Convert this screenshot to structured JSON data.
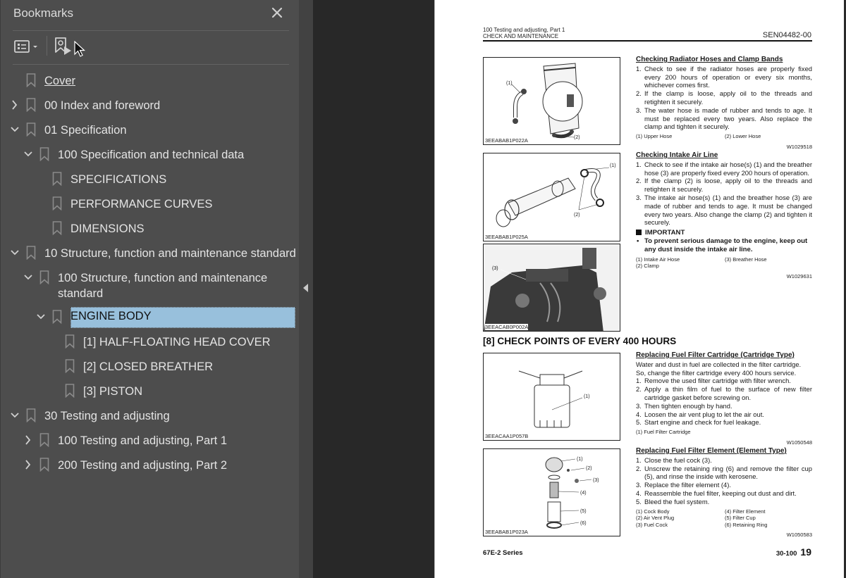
{
  "sidebar": {
    "title": "Bookmarks",
    "close_icon": "close-icon",
    "toolbar": {
      "options_icon": "bookmark-options-icon",
      "add_bookmark_icon": "add-bookmark-icon"
    },
    "items": [
      {
        "label": "Cover",
        "level": 0,
        "expander": "none",
        "underlined": true
      },
      {
        "label": "00 Index and foreword",
        "level": 0,
        "expander": "collapsed"
      },
      {
        "label": "01 Specification",
        "level": 0,
        "expander": "expanded"
      },
      {
        "label": "100 Specification and technical data",
        "level": 1,
        "expander": "expanded"
      },
      {
        "label": "SPECIFICATIONS",
        "level": 2,
        "expander": "none"
      },
      {
        "label": "PERFORMANCE CURVES",
        "level": 2,
        "expander": "none"
      },
      {
        "label": "DIMENSIONS",
        "level": 2,
        "expander": "none"
      },
      {
        "label": "10 Structure, function and maintenance standard",
        "level": 0,
        "expander": "expanded"
      },
      {
        "label": "100 Structure, function and maintenance standard",
        "level": 1,
        "expander": "expanded"
      },
      {
        "label": "ENGINE BODY",
        "level": 2,
        "expander": "expanded",
        "selected": true
      },
      {
        "label": "[1] HALF-FLOATING HEAD COVER",
        "level": 3,
        "expander": "none"
      },
      {
        "label": "[2] CLOSED BREATHER",
        "level": 3,
        "expander": "none"
      },
      {
        "label": "[3] PISTON",
        "level": 3,
        "expander": "none"
      },
      {
        "label": "30 Testing and adjusting",
        "level": 0,
        "expander": "expanded"
      },
      {
        "label": "100 Testing and adjusting, Part 1",
        "level": 1,
        "expander": "collapsed"
      },
      {
        "label": "200 Testing and adjusting, Part 2",
        "level": 1,
        "expander": "collapsed"
      }
    ],
    "selected_color": "#98c0dc"
  },
  "page": {
    "header": {
      "line1": "100 Testing and adjusting, Part 1",
      "line2": "CHECK AND MAINTENANCE",
      "doc_id": "SEN04482-00"
    },
    "figures": [
      {
        "caption": "3EEABAB1P022A",
        "callouts": [
          "(1)",
          "(2)"
        ]
      },
      {
        "caption": "3EEABAB1P025A",
        "callouts": [
          "(1)",
          "(2)"
        ]
      },
      {
        "caption": "3EEACAB0P002A",
        "callouts": [
          "(3)"
        ]
      },
      {
        "caption": "3EEACAA1P057B",
        "callouts": [
          "(1)"
        ]
      },
      {
        "caption": "3EEABAB1P023A",
        "callouts": [
          "(1)",
          "(2)",
          "(3)",
          "(4)",
          "(5)",
          "(6)"
        ]
      }
    ],
    "sections": {
      "radiator": {
        "title": "Checking Radiator Hoses and Clamp Bands",
        "steps": [
          "Check to see if the radiator hoses are properly fixed every 200 hours of operation or every six months, whichever comes first.",
          "If the clamp is loose, apply oil to the threads and retighten it securely.",
          "The water hose is made of rubber and tends to age.  It must be replaced every two years.  Also replace the clamp and tighten it securely."
        ],
        "legend": [
          "(1)  Upper Hose",
          "(2)  Lower Hose"
        ],
        "code": "W1029518"
      },
      "intake": {
        "title": "Checking Intake Air Line",
        "steps": [
          "Check to see if the intake air hose(s) (1) and the breather hose (3) are properly fixed every 200 hours of operation.",
          "If the clamp (2) is loose, apply oil to the threads and retighten it securely.",
          "The intake air hose(s) (1) and the breather hose (3) are made of rubber and tends to age.  It must be changed every two years.  Also change the clamp (2) and tighten it securely."
        ],
        "important_label": "IMPORTANT",
        "important_text": "To prevent serious damage to the engine, keep out any dust inside the intake air line.",
        "legend": [
          "(1)  Intake Air Hose",
          "(3)  Breather Hose",
          "(2)  Clamp",
          ""
        ],
        "code": "W1029631"
      },
      "heading_400": "[8]   CHECK POINTS OF EVERY 400 HOURS",
      "cartridge": {
        "title": "Replacing Fuel Filter Cartridge (Cartridge Type)",
        "intro": "Water and dust in fuel are collected in the filter cartridge. So, change the filter cartridge every 400 hours service.",
        "steps": [
          "Remove the used filter cartridge with filter wrench.",
          "Apply a thin film of fuel to the surface of new filter cartridge gasket before screwing on.",
          "Then tighten enough by hand.",
          "Loosen the air vent plug to let the air out.",
          "Start engine and check for fuel leakage."
        ],
        "legend": [
          "(1)  Fuel Filter Cartridge",
          ""
        ],
        "code": "W1050548"
      },
      "element": {
        "title": "Replacing Fuel Filter Element (Element Type)",
        "steps": [
          "Close the fuel cock (3).",
          "Unscrew the retaining ring (6) and remove the filter cup (5), and rinse the inside with kerosene.",
          "Replace the filter element (4).",
          "Reassemble the fuel filter, keeping out dust and dirt.",
          "Bleed the fuel system."
        ],
        "legend": [
          "(1)  Cock Body",
          "(4)  Filter Element",
          "(2)  Air Vent Plug",
          "(5)  Filter Cup",
          "(3)  Fuel Cock",
          "(6)  Retaining Ring"
        ],
        "code": "W1050583"
      }
    },
    "footer": {
      "series": "67E-2 Series",
      "section_no": "30-100",
      "page_no": "19"
    }
  }
}
